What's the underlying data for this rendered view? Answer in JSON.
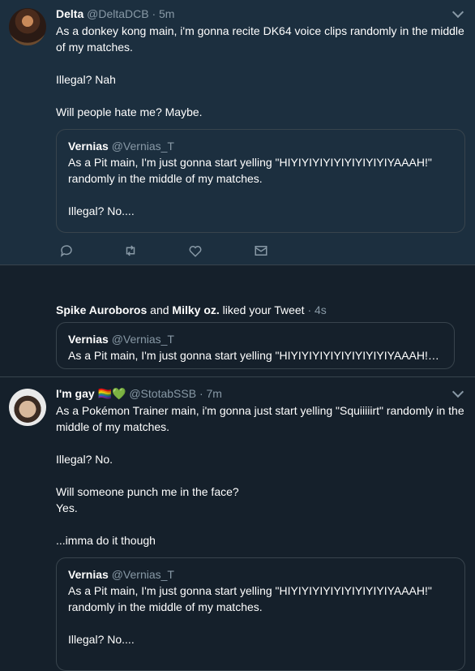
{
  "tweet1": {
    "name": "Delta",
    "handle": "@DeltaDCB",
    "time": "· 5m",
    "lines": [
      "As a donkey kong main, i'm gonna recite DK64 voice clips randomly in the middle of my matches.",
      "Illegal? Nah",
      "Will people hate me? Maybe."
    ],
    "quote": {
      "name": "Vernias",
      "handle": "@Vernias_T",
      "lines": [
        "As a Pit main, I'm just gonna start yelling \"HIYIYIYIYIYIYIYIYIYIYAAAH!\" randomly in the middle of my matches.",
        "Illegal? No...."
      ]
    },
    "actions": [
      "reply-icon",
      "retweet-icon",
      "like-icon",
      "message-icon"
    ]
  },
  "notification": {
    "user1": "Spike Auroboros",
    "and": " and ",
    "user2": "Milky oz.",
    "action": " liked your Tweet",
    "time": " · 4s",
    "quote": {
      "name": "Vernias",
      "handle": "@Vernias_T",
      "text": "As a Pit main, I'm just gonna start yelling \"HIYIYIYIYIYIYIYIYIYIYAAAH!\" rand..."
    }
  },
  "tweet3": {
    "name": "I'm gay",
    "emoji": "🏳️‍🌈💚",
    "handle": "@StotabSSB",
    "time": "· 7m",
    "lines": [
      "As a Pokémon Trainer main, i'm gonna just start yelling \"Squiiiiirt\" randomly in the middle of my matches.",
      "Illegal? No.",
      "Will someone punch me in the face?\nYes.",
      "...imma do it though"
    ],
    "quote": {
      "name": "Vernias",
      "handle": "@Vernias_T",
      "lines": [
        "As a Pit main, I'm just gonna start yelling \"HIYIYIYIYIYIYIYIYIYIYAAAH!\" randomly in the middle of my matches.",
        "Illegal? No...."
      ]
    }
  },
  "colors": {
    "background": "#15202b",
    "highlight": "#1c2f3f",
    "border": "#38444d",
    "secondary_text": "#8899a6",
    "like_red": "#e0245e"
  }
}
